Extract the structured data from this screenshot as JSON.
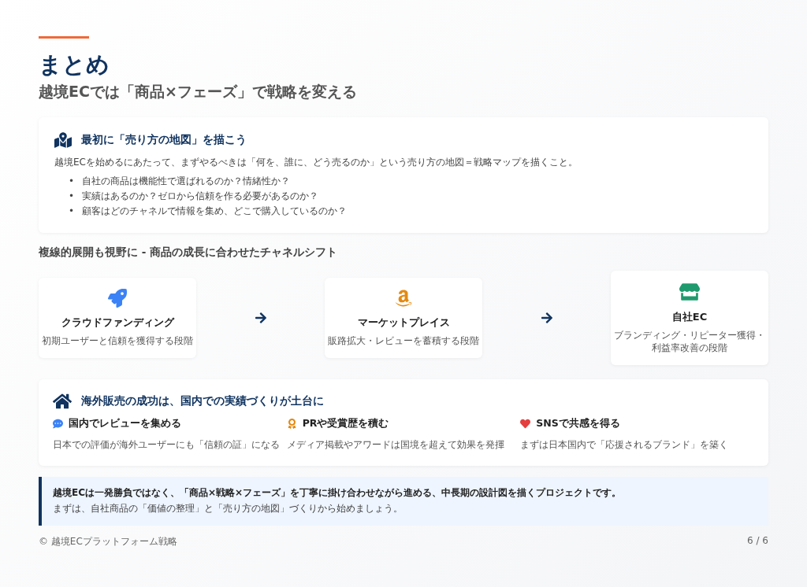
{
  "header": {
    "title": "まとめ",
    "subtitle": "越境ECでは「商品×フェーズ」で戦略を変える"
  },
  "map_card": {
    "title": "最初に「売り方の地図」を描こう",
    "lead": "越境ECを始めるにあたって、まずやるべきは「何を、誰に、どう売るのか」という売り方の地図＝戦略マップを描くこと。",
    "bullets": [
      {
        "marker": "•",
        "text": "自社の商品は機能性で選ばれるのか？情緒性か？"
      },
      {
        "marker": "•",
        "text": "実績はあるのか？ゼロから信頼を作る必要があるのか？"
      },
      {
        "marker": "•",
        "text": "顧客はどのチャネルで情報を集め、どこで購入しているのか？"
      }
    ]
  },
  "channel_section": {
    "title": "複線的展開も視野に - 商品の成長に合わせたチャネルシフト",
    "channels": [
      {
        "name": "クラウドファンディング",
        "description": "初期ユーザーと信頼を獲得する段階"
      },
      {
        "name": "マーケットプレイス",
        "description": "販路拡大・レビューを蓄積する段階"
      },
      {
        "name": "自社EC",
        "description": "ブランディング・リピーター獲得・利益率改善の段階"
      }
    ]
  },
  "domestic_card": {
    "title": "海外販売の成功は、国内での実績づくりが土台に",
    "points": [
      {
        "title": "国内でレビューを集める",
        "text": "日本での評価が海外ユーザーにも「信頼の証」になる"
      },
      {
        "title": "PRや受賞歴を積む",
        "text": "メディア掲載やアワードは国境を超えて効果を発揮"
      },
      {
        "title": "SNSで共感を得る",
        "text": "まずは日本国内で「応援されるブランド」を築く"
      }
    ]
  },
  "conclusion": {
    "lines": [
      "越境ECは一発勝負ではなく、「商品×戦略×フェーズ」を丁寧に掛け合わせながら進める、中長期の設計図を描くプロジェクトです。",
      "まずは、自社商品の「価値の整理」と「売り方の地図」づくりから始めましょう。"
    ]
  },
  "footer": {
    "copyright": "© 越境ECプラットフォーム戦略",
    "page": "6 / 6"
  }
}
